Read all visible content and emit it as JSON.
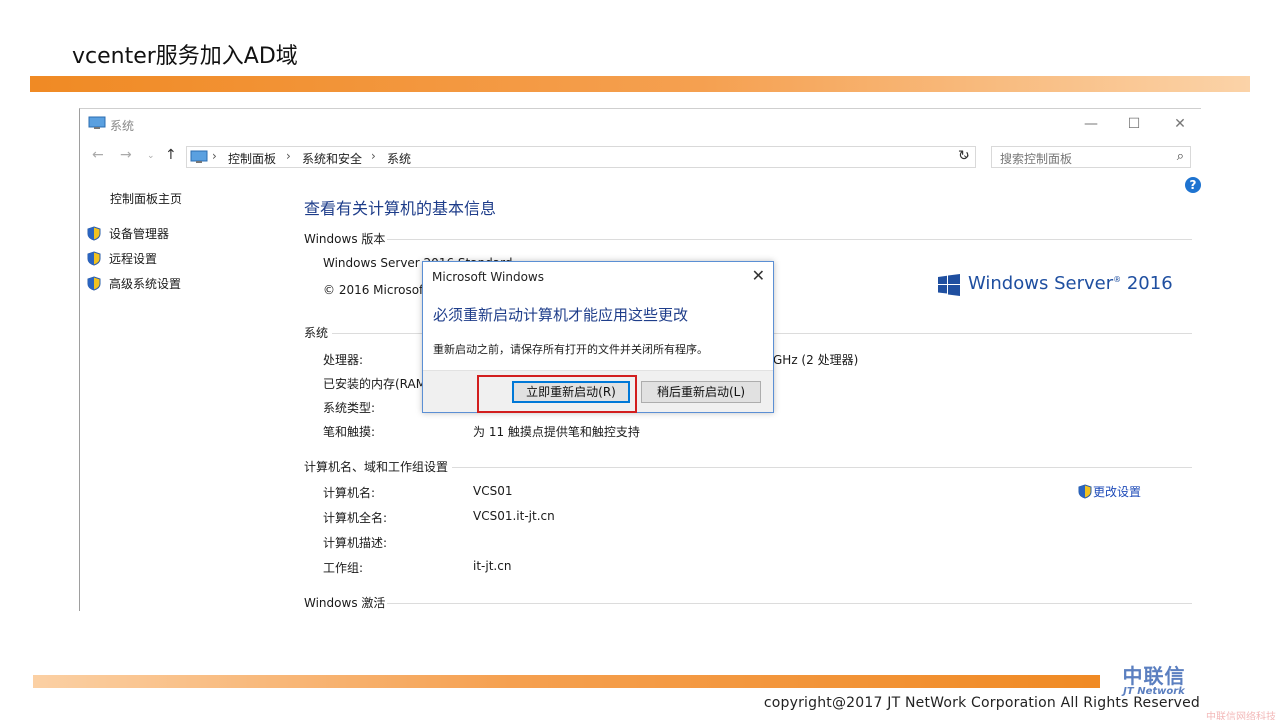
{
  "slide": {
    "title": "vcenter服务加入AD域",
    "copyright": "copyright@2017  JT NetWork Corporation All Rights Reserved",
    "logo_cn": "中联信",
    "logo_en": "JT Network",
    "watermark": "中联信网络科技"
  },
  "window": {
    "title": "系统",
    "breadcrumb": [
      "控制面板",
      "系统和安全",
      "系统"
    ],
    "search_placeholder": "搜索控制面板",
    "controls": {
      "minimize": "—",
      "maximize": "☐",
      "close": "✕"
    }
  },
  "left_pane": {
    "home": "控制面板主页",
    "items": [
      "设备管理器",
      "远程设置",
      "高级系统设置"
    ]
  },
  "main": {
    "heading": "查看有关计算机的基本信息",
    "edition_section": "Windows 版本",
    "edition_name": "Windows Server 2016 Standard",
    "edition_copyright": "© 2016 Microsoft Corporation。保留所有权利。",
    "brand_text": "Windows Server",
    "brand_version": "2016",
    "system_section": "系统",
    "system_rows": [
      {
        "label": "处理器:",
        "value": "GHz  (2 处理器)"
      },
      {
        "label": "已安装的内存(RAM):",
        "value": ""
      },
      {
        "label": "系统类型:",
        "value": ""
      },
      {
        "label": "笔和触摸:",
        "value": "为 11 触摸点提供笔和触控支持"
      }
    ],
    "computer_section": "计算机名、域和工作组设置",
    "computer_rows": [
      {
        "label": "计算机名:",
        "value": "VCS01"
      },
      {
        "label": "计算机全名:",
        "value": "VCS01.it-jt.cn"
      },
      {
        "label": "计算机描述:",
        "value": ""
      },
      {
        "label": "工作组:",
        "value": "it-jt.cn"
      }
    ],
    "change_settings": "更改设置",
    "activation_section": "Windows 激活"
  },
  "dialog": {
    "title": "Microsoft Windows",
    "heading": "必须重新启动计算机才能应用这些更改",
    "message": "重新启动之前，请保存所有打开的文件并关闭所有程序。",
    "restart_now": "立即重新启动(R)",
    "restart_later": "稍后重新启动(L)"
  },
  "colors": {
    "accent_orange": "#f08a24",
    "link_blue": "#1e3d8a",
    "highlight_red": "#d21e1e"
  }
}
